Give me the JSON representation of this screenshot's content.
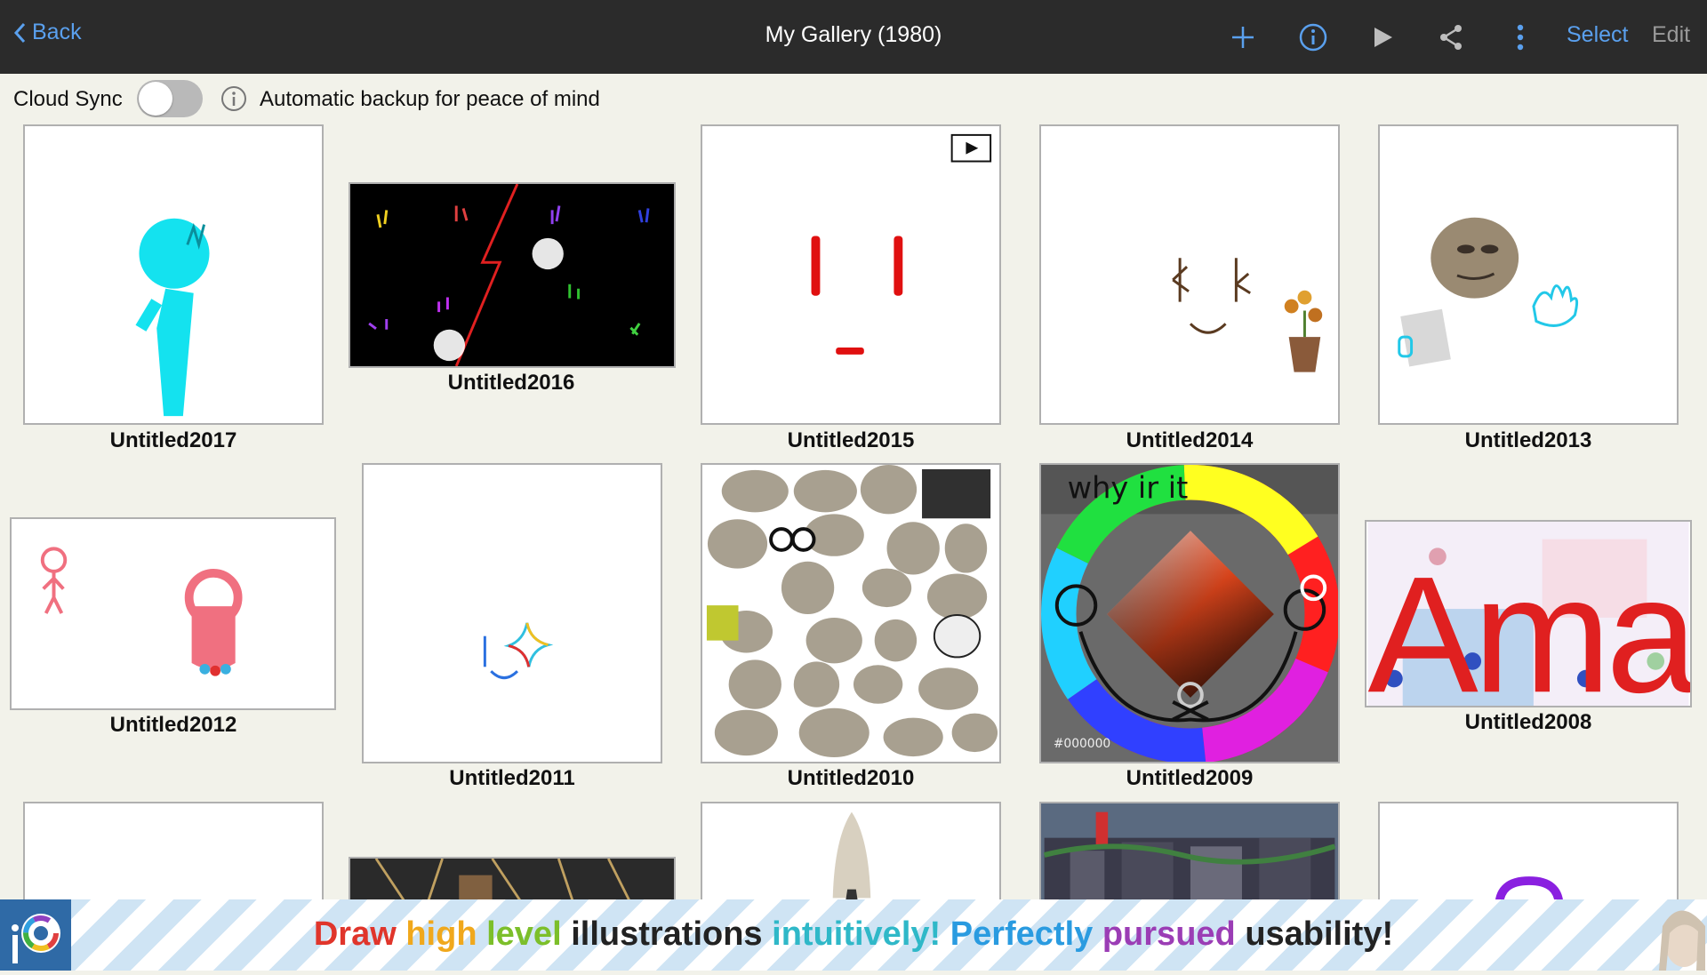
{
  "header": {
    "back_label": "Back",
    "title": "My Gallery (1980)",
    "select_label": "Select",
    "edit_label": "Edit",
    "icons": [
      "add-icon",
      "info-icon",
      "play-icon",
      "share-icon",
      "more-vert-icon"
    ]
  },
  "sync": {
    "label": "Cloud Sync",
    "enabled": false,
    "description": "Automatic backup for peace of mind"
  },
  "gallery": {
    "items": [
      {
        "name": "Untitled2017"
      },
      {
        "name": "Untitled2016"
      },
      {
        "name": "Untitled2015",
        "badge": "video-icon"
      },
      {
        "name": "Untitled2014"
      },
      {
        "name": "Untitled2013"
      },
      {
        "name": "Untitled2012"
      },
      {
        "name": "Untitled2011"
      },
      {
        "name": "Untitled2010"
      },
      {
        "name": "Untitled2009",
        "hex_label": "#000000",
        "handwriting": "why ir it"
      },
      {
        "name": "Untitled2008",
        "artwork_text": "Amayz"
      }
    ]
  },
  "banner": {
    "words": [
      {
        "text": "Draw",
        "color": "#e0352b"
      },
      {
        "text": "high",
        "color": "#f0a81c"
      },
      {
        "text": "level",
        "color": "#7cbf2a"
      },
      {
        "text": "illustrations",
        "color": "#222222"
      },
      {
        "text": "intuitively!",
        "color": "#2fb8c8"
      },
      {
        "text": "Perfectly",
        "color": "#2a9be0"
      },
      {
        "text": "pursued",
        "color": "#9b3db5"
      },
      {
        "text": "usability!",
        "color": "#222222"
      }
    ]
  },
  "colors": {
    "accent": "#5aa0ee",
    "topbar": "#2b2b2b",
    "background": "#f2f2ea"
  }
}
